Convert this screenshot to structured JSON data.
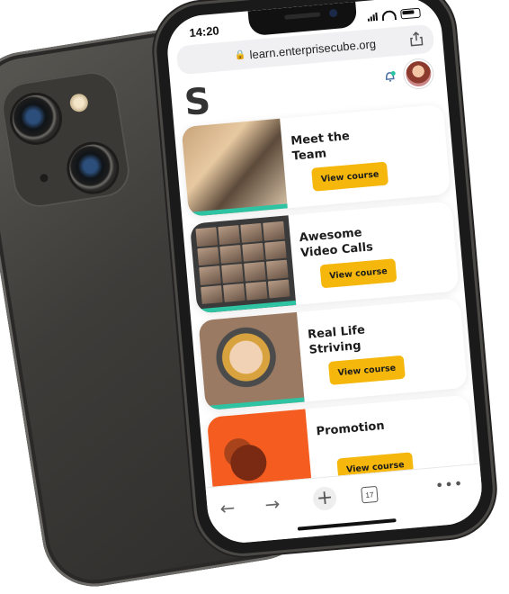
{
  "status_bar": {
    "time": "14:20"
  },
  "browser": {
    "url": "learn.enterprisecube.org",
    "tab_count": "17"
  },
  "app": {
    "logo": "S"
  },
  "courses": [
    {
      "title": "Meet the Team",
      "button": "View course"
    },
    {
      "title": "Awesome Video Calls",
      "button": "View course"
    },
    {
      "title": "Real Life Striving",
      "button": "View course"
    },
    {
      "title": "Promotion",
      "button": "View course"
    }
  ],
  "colors": {
    "accent_yellow": "#f5b70b",
    "progress_green": "#2ec4a3",
    "promo_orange": "#f45d1f",
    "phone_body": "#3e3c39"
  },
  "icons": [
    "lock-icon",
    "share-icon",
    "bell-icon",
    "back-arrow-icon",
    "forward-arrow-icon",
    "new-tab-icon",
    "tabs-icon",
    "more-icon"
  ]
}
